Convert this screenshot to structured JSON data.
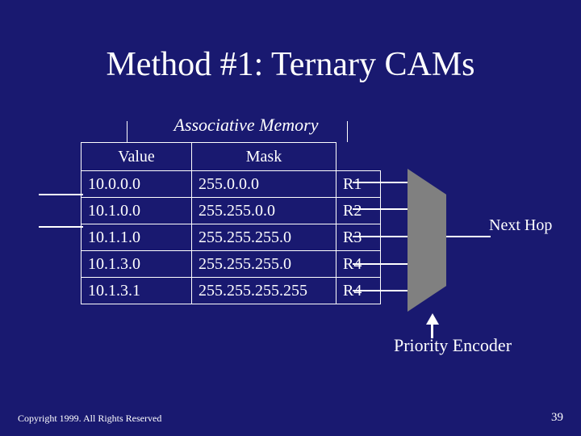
{
  "title": "Method #1: Ternary CAMs",
  "subtitle": "Associative Memory",
  "headers": {
    "value": "Value",
    "mask": "Mask"
  },
  "rows": [
    {
      "value": "10.0.0.0",
      "mask": "255.0.0.0",
      "r": "R1"
    },
    {
      "value": "10.1.0.0",
      "mask": "255.255.0.0",
      "r": "R2"
    },
    {
      "value": "10.1.1.0",
      "mask": "255.255.255.0",
      "r": "R3"
    },
    {
      "value": "10.1.3.0",
      "mask": "255.255.255.0",
      "r": "R4"
    },
    {
      "value": "10.1.3.1",
      "mask": "255.255.255.255",
      "r": "R4"
    }
  ],
  "next_hop": "Next Hop",
  "priority_encoder": "Priority Encoder",
  "copyright": "Copyright 1999. All Rights Reserved",
  "page": "39"
}
